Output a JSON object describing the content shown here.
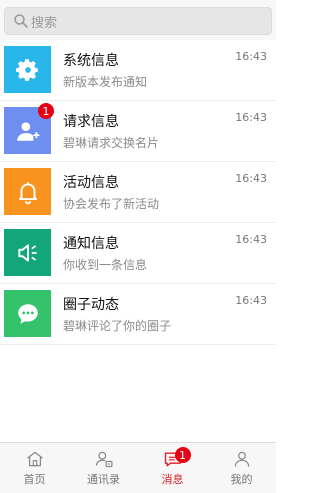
{
  "search": {
    "placeholder": "搜索",
    "icon": "search-icon"
  },
  "messages": [
    {
      "title": "系统信息",
      "subtitle": "新版本发布通知",
      "time": "16:43",
      "icon": "gear-icon",
      "color": "#29b6ea",
      "badge": ""
    },
    {
      "title": "请求信息",
      "subtitle": "碧琳请求交换名片",
      "time": "16:43",
      "icon": "add-contact-icon",
      "color": "#6f8ff0",
      "badge": "1"
    },
    {
      "title": "活动信息",
      "subtitle": "协会发布了新活动",
      "time": "16:43",
      "icon": "bell-icon",
      "color": "#f7931e",
      "badge": ""
    },
    {
      "title": "通知信息",
      "subtitle": "你收到一条信息",
      "time": "16:43",
      "icon": "speaker-icon",
      "color": "#13a67a",
      "badge": ""
    },
    {
      "title": "圈子动态",
      "subtitle": "碧琳评论了你的圈子",
      "time": "16:43",
      "icon": "chat-bubble-icon",
      "color": "#34c26a",
      "badge": ""
    }
  ],
  "tabs": [
    {
      "label": "首页",
      "icon": "home-icon",
      "active": false,
      "badge": ""
    },
    {
      "label": "通讯录",
      "icon": "contacts-icon",
      "active": false,
      "badge": ""
    },
    {
      "label": "消息",
      "icon": "message-icon",
      "active": true,
      "badge": "1"
    },
    {
      "label": "我的",
      "icon": "profile-icon",
      "active": false,
      "badge": ""
    }
  ],
  "colors": {
    "active_tab": "#e11b22",
    "badge": "#e60012"
  }
}
